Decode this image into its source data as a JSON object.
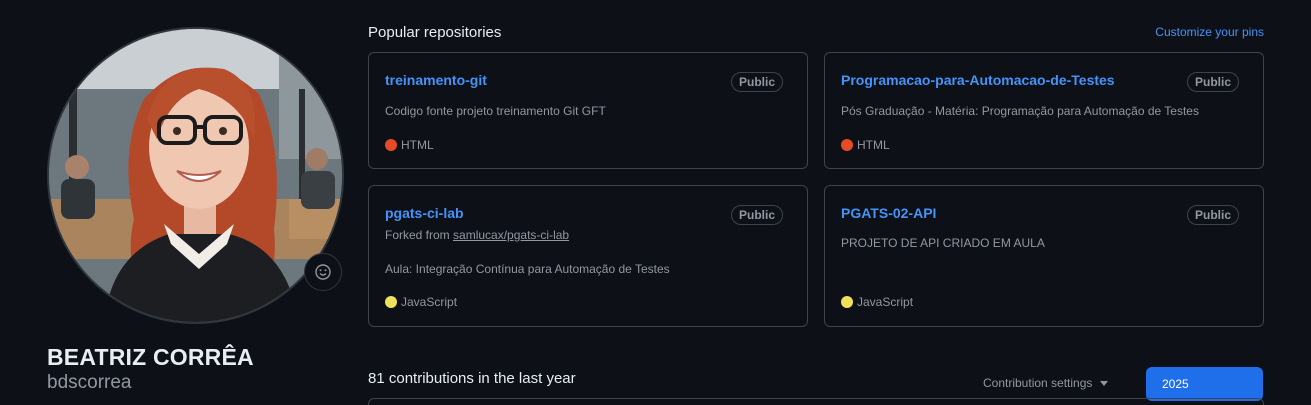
{
  "profile": {
    "name": "BEATRIZ CORRÊA",
    "username": "bdscorrea",
    "status_icon": "smiley-icon"
  },
  "popular": {
    "title": "Popular repositories",
    "customize_link": "Customize your pins"
  },
  "repos": [
    {
      "name": "treinamento-git",
      "visibility": "Public",
      "description": "Codigo fonte projeto treinamento Git GFT",
      "language": "HTML",
      "language_color": "#e34c26"
    },
    {
      "name": "Programacao-para-Automacao-de-Testes",
      "visibility": "Public",
      "description": "Pós Graduação - Matéria: Programação para Automação de Testes",
      "language": "HTML",
      "language_color": "#e34c26"
    },
    {
      "name": "pgats-ci-lab",
      "visibility": "Public",
      "forked_prefix": "Forked from",
      "forked_from": "samlucax/pgats-ci-lab",
      "description": "Aula: Integração Contínua para Automação de Testes",
      "language": "JavaScript",
      "language_color": "#f1e05a"
    },
    {
      "name": "PGATS-02-API",
      "visibility": "Public",
      "description": "PROJETO DE API CRIADO EM AULA",
      "language": "JavaScript",
      "language_color": "#f1e05a"
    }
  ],
  "contributions": {
    "title": "81 contributions in the last year",
    "settings_label": "Contribution settings",
    "year": "2025"
  },
  "colors": {
    "background": "#0d1117",
    "link": "#4493f8",
    "border": "#3d444d",
    "accent_button": "#1f6feb"
  }
}
